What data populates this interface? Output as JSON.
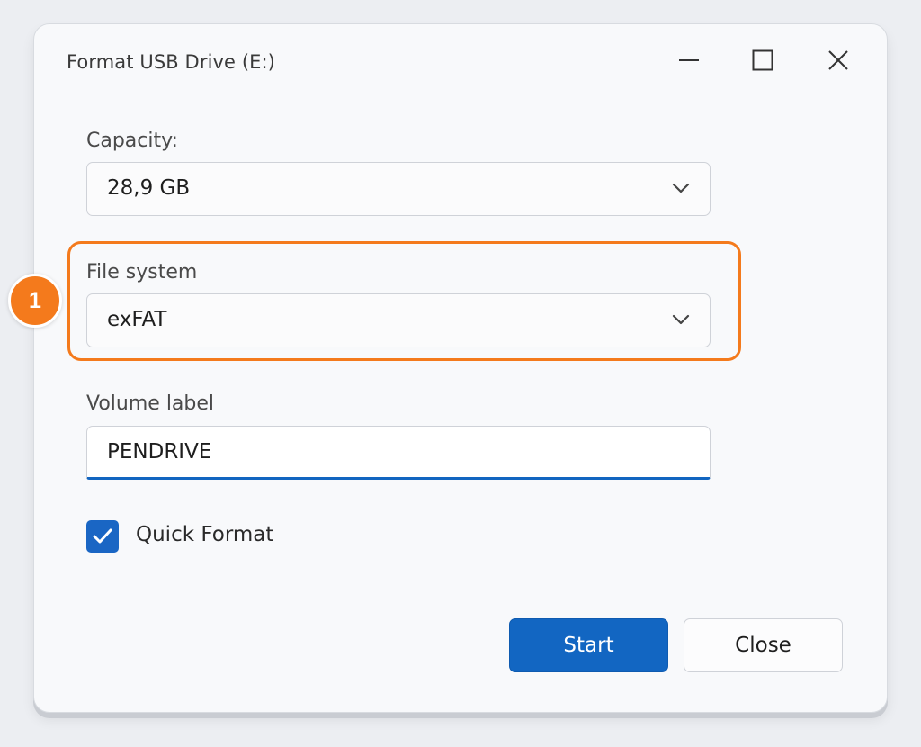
{
  "window": {
    "title": "Format USB Drive (E:)"
  },
  "capacity": {
    "label": "Capacity:",
    "value": "28,9 GB"
  },
  "file_system": {
    "label": "File system",
    "value": "exFAT",
    "step_number": "1"
  },
  "volume_label": {
    "label": "Volume label",
    "value": "PENDRIVE"
  },
  "quick_format": {
    "label": "Quick Format",
    "checked": true
  },
  "buttons": {
    "start": "Start",
    "close": "Close"
  },
  "colors": {
    "accent": "#1266c2",
    "highlight": "#f47a1c"
  }
}
